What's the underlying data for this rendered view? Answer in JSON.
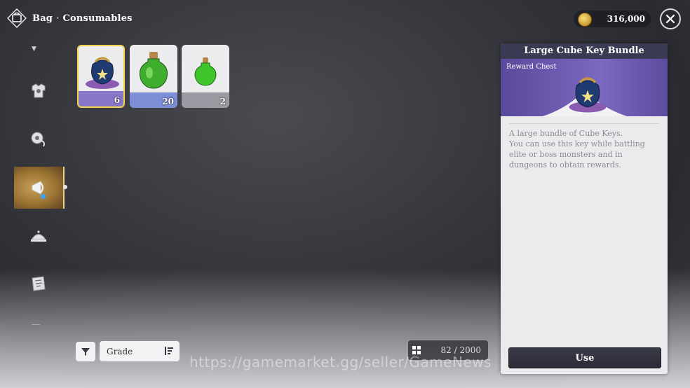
{
  "header": {
    "section": "Bag",
    "subsection": "Consumables",
    "separator": "·"
  },
  "currency": {
    "gold": "316,000"
  },
  "sidebar": {
    "items": [
      {
        "name": "equipment",
        "icon": "armor-icon",
        "active": false
      },
      {
        "name": "materials",
        "icon": "gear-sack-icon",
        "active": false
      },
      {
        "name": "consumables",
        "icon": "horn-icon",
        "active": true
      },
      {
        "name": "food",
        "icon": "cloche-icon",
        "active": false
      },
      {
        "name": "misc",
        "icon": "scroll-map-icon",
        "active": false
      }
    ]
  },
  "inventory": {
    "items": [
      {
        "name": "Large Cube Key Bundle",
        "qty": "6",
        "band_color": "#8a76c9",
        "selected": true
      },
      {
        "name": "Green Potion",
        "qty": "20",
        "band_color": "#7b8ed6",
        "selected": false
      },
      {
        "name": "Small Green Potion",
        "qty": "2",
        "band_color": "#9a9aa3",
        "selected": false
      }
    ]
  },
  "controls": {
    "sort_label": "Grade",
    "capacity": "82 / 2000"
  },
  "watermark": "https://gamemarket.gg/seller/GameNews",
  "detail": {
    "title": "Large Cube Key Bundle",
    "type": "Reward Chest",
    "description": [
      "A large bundle of Cube Keys.",
      "You can use this key while battling elite or boss monsters and in dungeons to obtain rewards."
    ],
    "use_label": "Use"
  },
  "colors": {
    "accent_gold": "#f3d34a",
    "panel_header": "#3a3b52",
    "hero_purple": "#7c68c0"
  }
}
